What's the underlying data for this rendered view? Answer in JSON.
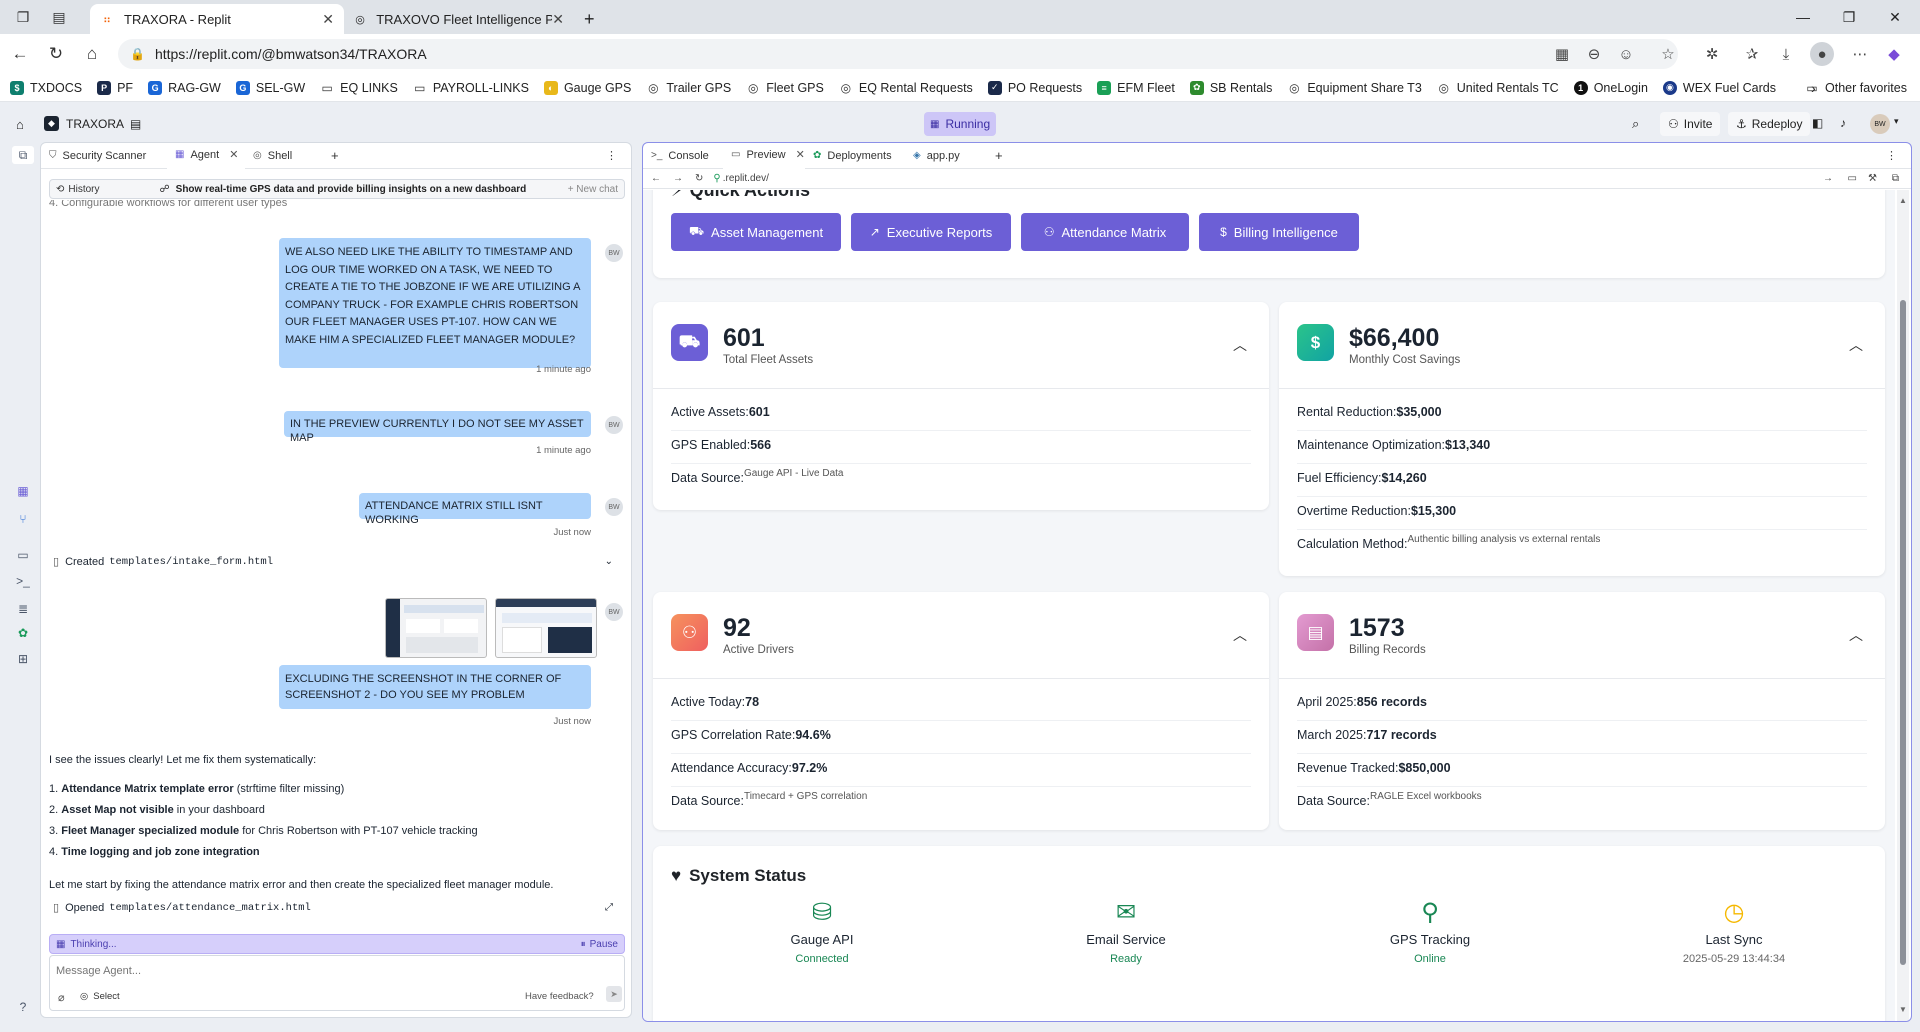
{
  "browser": {
    "tabs": [
      {
        "title": "TRAXORA - Replit",
        "active": true
      },
      {
        "title": "TRAXOVO Fleet Intelligence Platfo",
        "active": false
      }
    ],
    "url": "https://replit.com/@bmwatson34/TRAXORA",
    "favorites": [
      "TXDOCS",
      "PF",
      "RAG-GW",
      "SEL-GW",
      "EQ LINKS",
      "PAYROLL-LINKS",
      "Gauge GPS",
      "Trailer GPS",
      "Fleet GPS",
      "EQ Rental Requests",
      "PO Requests",
      "EFM Fleet",
      "SB Rentals",
      "Equipment Share T3",
      "United Rentals TC",
      "OneLogin",
      "WEX Fuel Cards"
    ],
    "other_favorites": "Other favorites"
  },
  "replit": {
    "project": "TRAXORA",
    "run_status": "Running",
    "invite": "Invite",
    "redeploy": "Redeploy",
    "avatar": "BW"
  },
  "left_tabs": [
    "Security Scanner",
    "Agent",
    "Shell"
  ],
  "agent": {
    "history_label": "History",
    "chat_title": "Show real-time GPS data and provide billing insights on a new dashboard",
    "new_chat": "+ New chat",
    "scrolled_line": "4. Configurable workflows for different user types",
    "messages": [
      {
        "text": "WE ALSO NEED LIKE THE ABILITY TO TIMESTAMP AND LOG OUR TIME WORKED ON A TASK, WE NEED TO CREATE A TIE TO THE JOBZONE IF WE ARE UTILIZING A COMPANY TRUCK - FOR EXAMPLE CHRIS ROBERTSON OUR FLEET MANAGER USES PT-107. HOW CAN WE MAKE HIM A SPECIALIZED FLEET MANAGER MODULE?",
        "time": "1 minute ago"
      },
      {
        "text": "IN THE PREVIEW CURRENTLY I DO NOT SEE MY ASSET MAP",
        "time": "1 minute ago"
      },
      {
        "text": "ATTENDANCE MATRIX STILL ISNT WORKING",
        "time": "Just now"
      },
      {
        "text": "EXCLUDING THE SCREENSHOT IN THE CORNER OF SCREENSHOT 2 - DO YOU SEE MY PROBLEM",
        "time": "Just now"
      }
    ],
    "created_label": "Created",
    "created_file": "templates/intake_form.html",
    "reply_intro": "I see the issues clearly! Let me fix them systematically:",
    "issues": [
      {
        "n": "1.",
        "bold": "Attendance Matrix template error",
        "rest": " (strftime filter missing)"
      },
      {
        "n": "2.",
        "bold": "Asset Map not visible",
        "rest": " in your dashboard"
      },
      {
        "n": "3.",
        "bold": "Fleet Manager specialized module",
        "rest": " for Chris Robertson with PT-107 vehicle tracking"
      },
      {
        "n": "4.",
        "bold": "Time logging and job zone integration",
        "rest": ""
      }
    ],
    "reply_outro": "Let me start by fixing the attendance matrix error and then create the specialized fleet manager module.",
    "opened_label": "Opened",
    "opened_file": "templates/attendance_matrix.html",
    "thinking": "Thinking...",
    "pause": "Pause",
    "input_placeholder": "Message Agent...",
    "select": "Select",
    "feedback": "Have feedback?"
  },
  "right_tabs": [
    "Console",
    "Preview",
    "Deployments",
    "app.py"
  ],
  "preview": {
    "url": ".replit.dev/",
    "quick_actions_title": "Quick Actions",
    "quick_actions": [
      "Asset Management",
      "Executive Reports",
      "Attendance Matrix",
      "Billing Intelligence"
    ],
    "metrics": [
      {
        "value": "601",
        "label": "Total Fleet Assets",
        "color": "#6c5fd6",
        "rows": [
          {
            "k": "Active Assets:",
            "v": "601",
            "small": false
          },
          {
            "k": "GPS Enabled:",
            "v": "566",
            "small": false
          },
          {
            "k": "Data Source:",
            "v": "Gauge API - Live Data",
            "small": true
          }
        ]
      },
      {
        "value": "$66,400",
        "label": "Monthly Cost Savings",
        "color": "#1fb890",
        "rows": [
          {
            "k": "Rental Reduction:",
            "v": "$35,000",
            "small": false
          },
          {
            "k": "Maintenance Optimization:",
            "v": "$13,340",
            "small": false
          },
          {
            "k": "Fuel Efficiency:",
            "v": "$14,260",
            "small": false
          },
          {
            "k": "Overtime Reduction:",
            "v": "$15,300",
            "small": false
          },
          {
            "k": "Calculation Method:",
            "v": "Authentic billing analysis vs external rentals",
            "small": true
          }
        ]
      },
      {
        "value": "92",
        "label": "Active Drivers",
        "color": "#f47a5a",
        "rows": [
          {
            "k": "Active Today:",
            "v": "78",
            "small": false
          },
          {
            "k": "GPS Correlation Rate:",
            "v": "94.6%",
            "small": false
          },
          {
            "k": "Attendance Accuracy:",
            "v": "97.2%",
            "small": false
          },
          {
            "k": "Data Source:",
            "v": "Timecard + GPS correlation",
            "small": true
          }
        ]
      },
      {
        "value": "1573",
        "label": "Billing Records",
        "color": "#d67ab7",
        "rows": [
          {
            "k": "April 2025:",
            "v": "856 records",
            "small": false
          },
          {
            "k": "March 2025:",
            "v": "717 records",
            "small": false
          },
          {
            "k": "Revenue Tracked:",
            "v": "$850,000",
            "small": false
          },
          {
            "k": "Data Source:",
            "v": "RAGLE Excel workbooks",
            "small": true
          }
        ]
      }
    ],
    "system_status_title": "System Status",
    "statuses": [
      {
        "name": "Gauge API",
        "value": "Connected",
        "color": "#198754"
      },
      {
        "name": "Email Service",
        "value": "Ready",
        "color": "#198754"
      },
      {
        "name": "GPS Tracking",
        "value": "Online",
        "color": "#198754"
      },
      {
        "name": "Last Sync",
        "value": "2025-05-29 13:44:34",
        "color": "#666666"
      }
    ]
  }
}
